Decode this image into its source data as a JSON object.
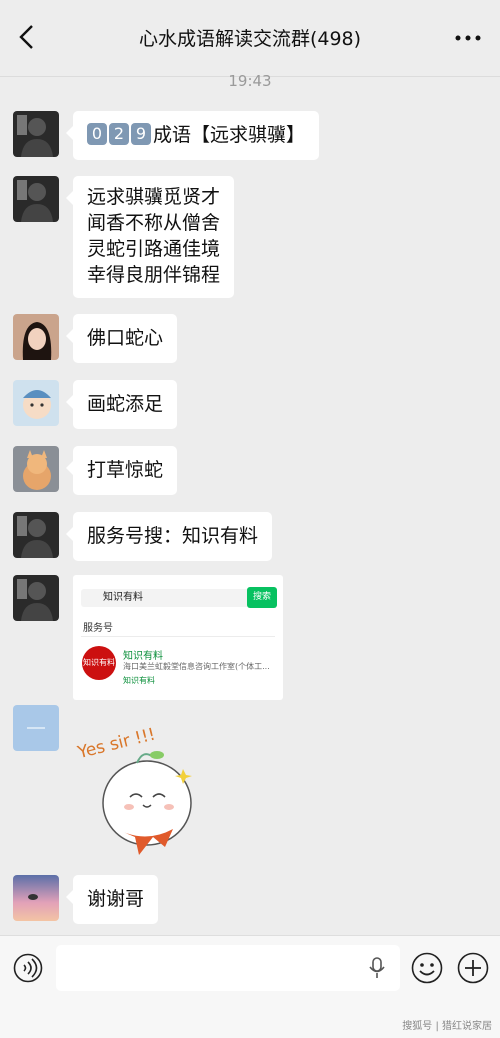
{
  "header": {
    "title": "心水成语解读交流群(498)"
  },
  "timestamp": "19:43",
  "messages": [
    {
      "k1": "0",
      "k2": "2",
      "k3": "9",
      "text": "成语【远求骐骥】"
    },
    {
      "text": "远求骐骥觅贤才\n闻香不称从僧舍\n灵蛇引路通佳境\n幸得良朋伴锦程"
    },
    {
      "text": "佛口蛇心"
    },
    {
      "text": "画蛇添足"
    },
    {
      "text": "打草惊蛇"
    },
    {
      "text": "服务号搜：知识有料"
    },
    {
      "search_value": "知识有料",
      "search_button": "搜索",
      "section": "服务号",
      "account_name": "知识有料",
      "account_desc": "海口美兰虹毅堂信息咨询工作室(个体工...",
      "account_sub": "知识有料",
      "logo_text": "知识有料"
    },
    {
      "sticker_text": "Yes sir !!!"
    },
    {
      "text": "谢谢哥"
    }
  ],
  "watermark": "搜狐号 | 猎红说家居"
}
